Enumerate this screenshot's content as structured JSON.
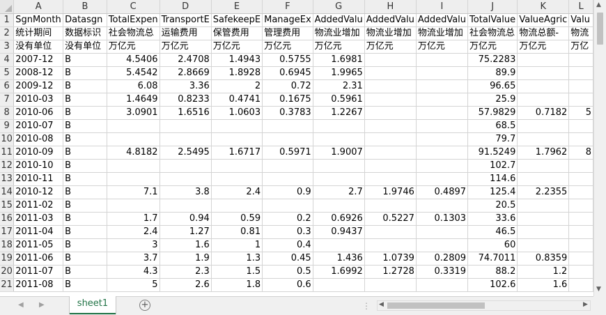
{
  "columns": [
    "A",
    "B",
    "C",
    "D",
    "E",
    "F",
    "G",
    "H",
    "I",
    "J",
    "K",
    "L"
  ],
  "rows": [
    {
      "n": "1",
      "c": [
        "SgnMonth",
        "Datasgn",
        "TotalExpen",
        "TransportE",
        "SafekeepE",
        "ManageEx",
        "AddedValu",
        "AddedValu",
        "AddedValu",
        "TotalValue",
        "ValueAgric",
        "Valu"
      ]
    },
    {
      "n": "2",
      "c": [
        "统计期间",
        "数据标识",
        "社会物流总",
        "运输费用",
        "保管费用",
        "管理费用",
        "物流业增加",
        "物流业增加",
        "物流业增加",
        "社会物流总",
        "物流总额-",
        "物流"
      ]
    },
    {
      "n": "3",
      "c": [
        "没有单位",
        "没有单位",
        "万亿元",
        "万亿元",
        "万亿元",
        "万亿元",
        "万亿元",
        "万亿元",
        "万亿元",
        "万亿元",
        "万亿元",
        "万亿"
      ]
    },
    {
      "n": "4",
      "c": [
        "2007-12",
        "B",
        "4.5406",
        "2.4708",
        "1.4943",
        "0.5755",
        "1.6981",
        "",
        "",
        "75.2283",
        "",
        ""
      ]
    },
    {
      "n": "5",
      "c": [
        "2008-12",
        "B",
        "5.4542",
        "2.8669",
        "1.8928",
        "0.6945",
        "1.9965",
        "",
        "",
        "89.9",
        "",
        ""
      ]
    },
    {
      "n": "6",
      "c": [
        "2009-12",
        "B",
        "6.08",
        "3.36",
        "2",
        "0.72",
        "2.31",
        "",
        "",
        "96.65",
        "",
        ""
      ]
    },
    {
      "n": "7",
      "c": [
        "2010-03",
        "B",
        "1.4649",
        "0.8233",
        "0.4741",
        "0.1675",
        "0.5961",
        "",
        "",
        "25.9",
        "",
        ""
      ]
    },
    {
      "n": "8",
      "c": [
        "2010-06",
        "B",
        "3.0901",
        "1.6516",
        "1.0603",
        "0.3783",
        "1.2267",
        "",
        "",
        "57.9829",
        "0.7182",
        "5"
      ]
    },
    {
      "n": "9",
      "c": [
        "2010-07",
        "B",
        "",
        "",
        "",
        "",
        "",
        "",
        "",
        "68.5",
        "",
        ""
      ]
    },
    {
      "n": "10",
      "c": [
        "2010-08",
        "B",
        "",
        "",
        "",
        "",
        "",
        "",
        "",
        "79.7",
        "",
        ""
      ]
    },
    {
      "n": "11",
      "c": [
        "2010-09",
        "B",
        "4.8182",
        "2.5495",
        "1.6717",
        "0.5971",
        "1.9007",
        "",
        "",
        "91.5249",
        "1.7962",
        "8"
      ]
    },
    {
      "n": "12",
      "c": [
        "2010-10",
        "B",
        "",
        "",
        "",
        "",
        "",
        "",
        "",
        "102.7",
        "",
        ""
      ]
    },
    {
      "n": "13",
      "c": [
        "2010-11",
        "B",
        "",
        "",
        "",
        "",
        "",
        "",
        "",
        "114.6",
        "",
        ""
      ]
    },
    {
      "n": "14",
      "c": [
        "2010-12",
        "B",
        "7.1",
        "3.8",
        "2.4",
        "0.9",
        "2.7",
        "1.9746",
        "0.4897",
        "125.4",
        "2.2355",
        ""
      ]
    },
    {
      "n": "15",
      "c": [
        "2011-02",
        "B",
        "",
        "",
        "",
        "",
        "",
        "",
        "",
        "20.5",
        "",
        ""
      ]
    },
    {
      "n": "16",
      "c": [
        "2011-03",
        "B",
        "1.7",
        "0.94",
        "0.59",
        "0.2",
        "0.6926",
        "0.5227",
        "0.1303",
        "33.6",
        "",
        ""
      ]
    },
    {
      "n": "17",
      "c": [
        "2011-04",
        "B",
        "2.4",
        "1.27",
        "0.81",
        "0.3",
        "0.9437",
        "",
        "",
        "46.5",
        "",
        ""
      ]
    },
    {
      "n": "18",
      "c": [
        "2011-05",
        "B",
        "3",
        "1.6",
        "1",
        "0.4",
        "",
        "",
        "",
        "60",
        "",
        ""
      ]
    },
    {
      "n": "19",
      "c": [
        "2011-06",
        "B",
        "3.7",
        "1.9",
        "1.3",
        "0.45",
        "1.436",
        "1.0739",
        "0.2809",
        "74.7011",
        "0.8359",
        ""
      ]
    },
    {
      "n": "20",
      "c": [
        "2011-07",
        "B",
        "4.3",
        "2.3",
        "1.5",
        "0.5",
        "1.6992",
        "1.2728",
        "0.3319",
        "88.2",
        "1.2",
        ""
      ]
    },
    {
      "n": "21",
      "c": [
        "2011-08",
        "B",
        "5",
        "2.6",
        "1.8",
        "0.6",
        "",
        "",
        "",
        "102.6",
        "1.6",
        ""
      ]
    }
  ],
  "sheet_tab": "sheet1"
}
